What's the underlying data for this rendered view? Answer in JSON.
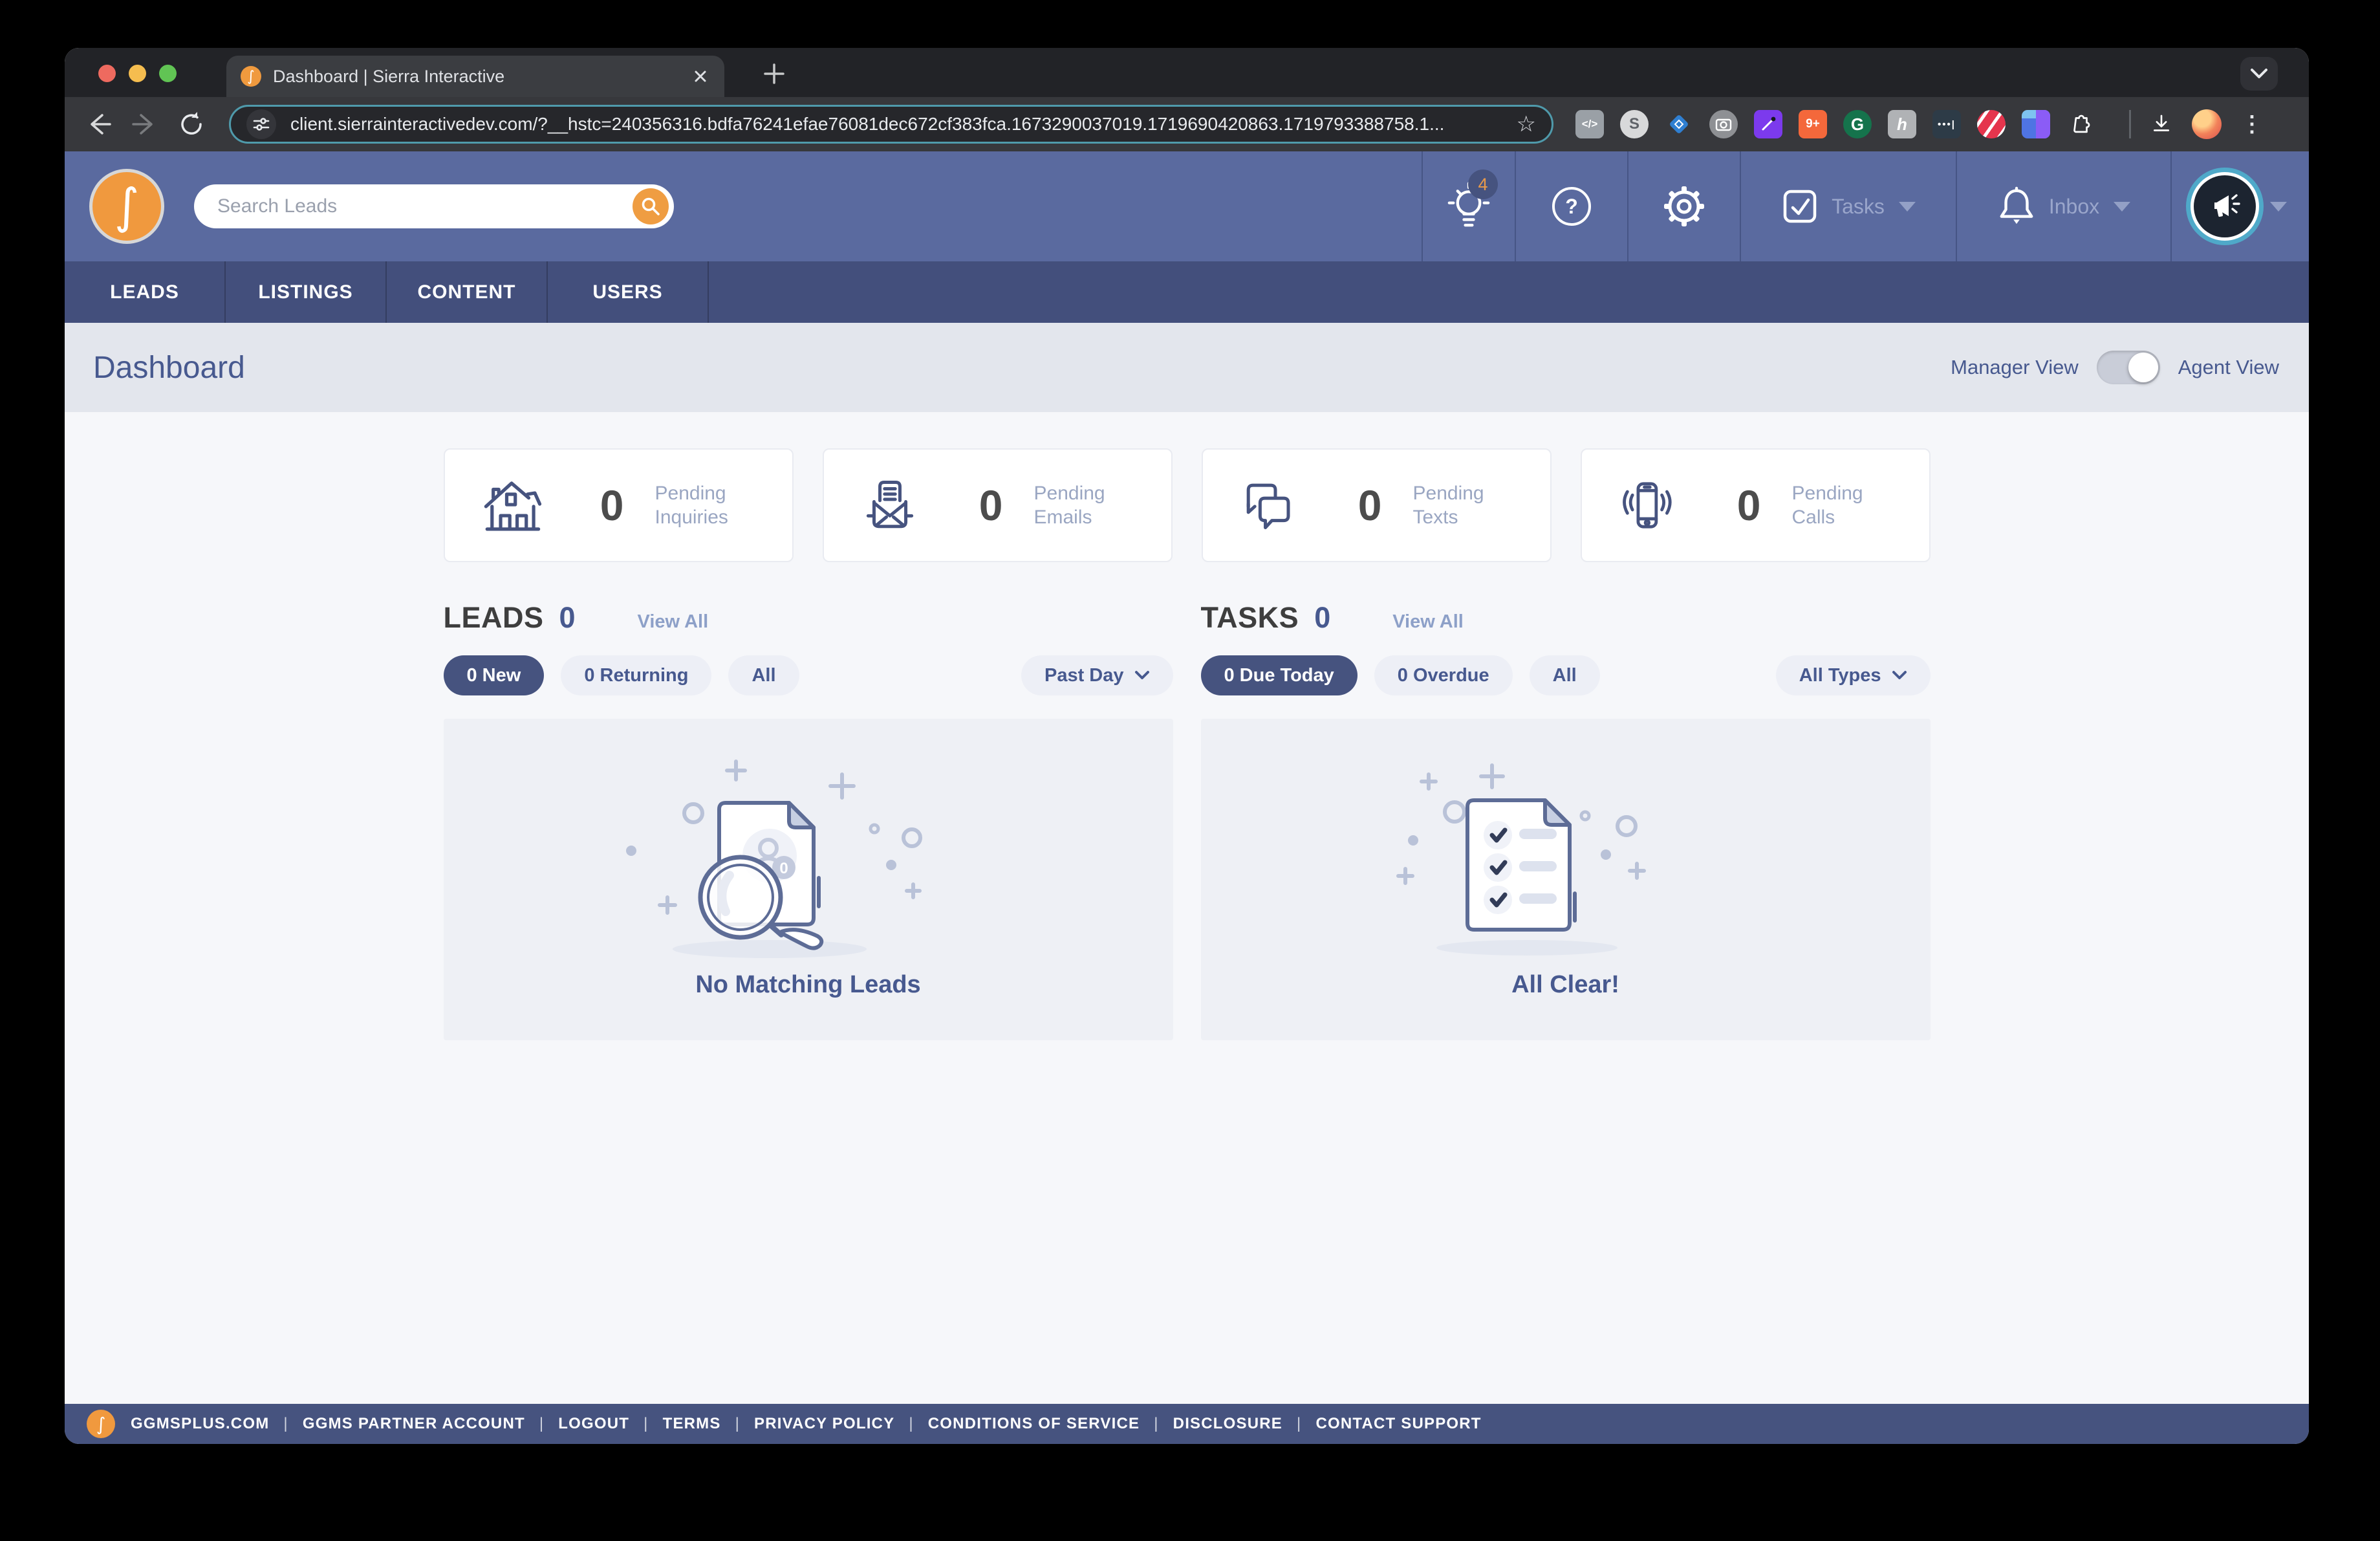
{
  "browser": {
    "tab_title": "Dashboard | Sierra Interactive",
    "url": "client.sierrainteractivedev.com/?__hstc=240356316.bdfa76241efae76081dec672cf383fca.1673290037019.1719690420863.1719793388758.1...",
    "star_glyph": "☆",
    "kebab_glyph": "⋮",
    "extensions": {
      "code_glyph": "</>",
      "s_glyph": "S",
      "nineplus_glyph": "9+",
      "grammarly_glyph": "G",
      "h_glyph": "h",
      "dots_glyph": "•••|"
    }
  },
  "brand": {
    "logo_glyph": "∫"
  },
  "header": {
    "search_placeholder": "Search Leads",
    "notification_count": "4",
    "help_glyph": "?",
    "tasks_label": "Tasks",
    "inbox_label": "Inbox"
  },
  "nav": {
    "items": [
      "LEADS",
      "LISTINGS",
      "CONTENT",
      "USERS"
    ]
  },
  "page": {
    "title": "Dashboard",
    "manager_view_label": "Manager View",
    "agent_view_label": "Agent View"
  },
  "stats": [
    {
      "value": "0",
      "label": "Pending Inquiries"
    },
    {
      "value": "0",
      "label": "Pending Emails"
    },
    {
      "value": "0",
      "label": "Pending Texts"
    },
    {
      "value": "0",
      "label": "Pending Calls"
    }
  ],
  "leads": {
    "title": "LEADS",
    "count": "0",
    "view_all": "View All",
    "filters": [
      "0 New",
      "0 Returning",
      "All"
    ],
    "range": "Past Day",
    "empty_caption": "No Matching Leads",
    "doc_badge": "0"
  },
  "tasks": {
    "title": "TASKS",
    "count": "0",
    "view_all": "View All",
    "filters": [
      "0 Due Today",
      "0 Overdue",
      "All"
    ],
    "range": "All Types",
    "empty_caption": "All Clear!"
  },
  "footer": {
    "links": [
      "GGMSPLUS.COM",
      "GGMS PARTNER ACCOUNT",
      "LOGOUT",
      "TERMS",
      "PRIVACY POLICY",
      "CONDITIONS OF SERVICE",
      "DISCLOSURE",
      "CONTACT SUPPORT"
    ]
  },
  "colors": {
    "header_blue": "#5a6a9f",
    "nav_blue": "#434f7c",
    "footer_blue": "#46537f",
    "accent_orange": "#f0993e",
    "active_pill": "#46537f",
    "page_bg": "#f6f7fa",
    "panel_bg": "#eef0f5",
    "url_focus_teal": "#4f9aab",
    "icon_navy": "#46537f"
  }
}
